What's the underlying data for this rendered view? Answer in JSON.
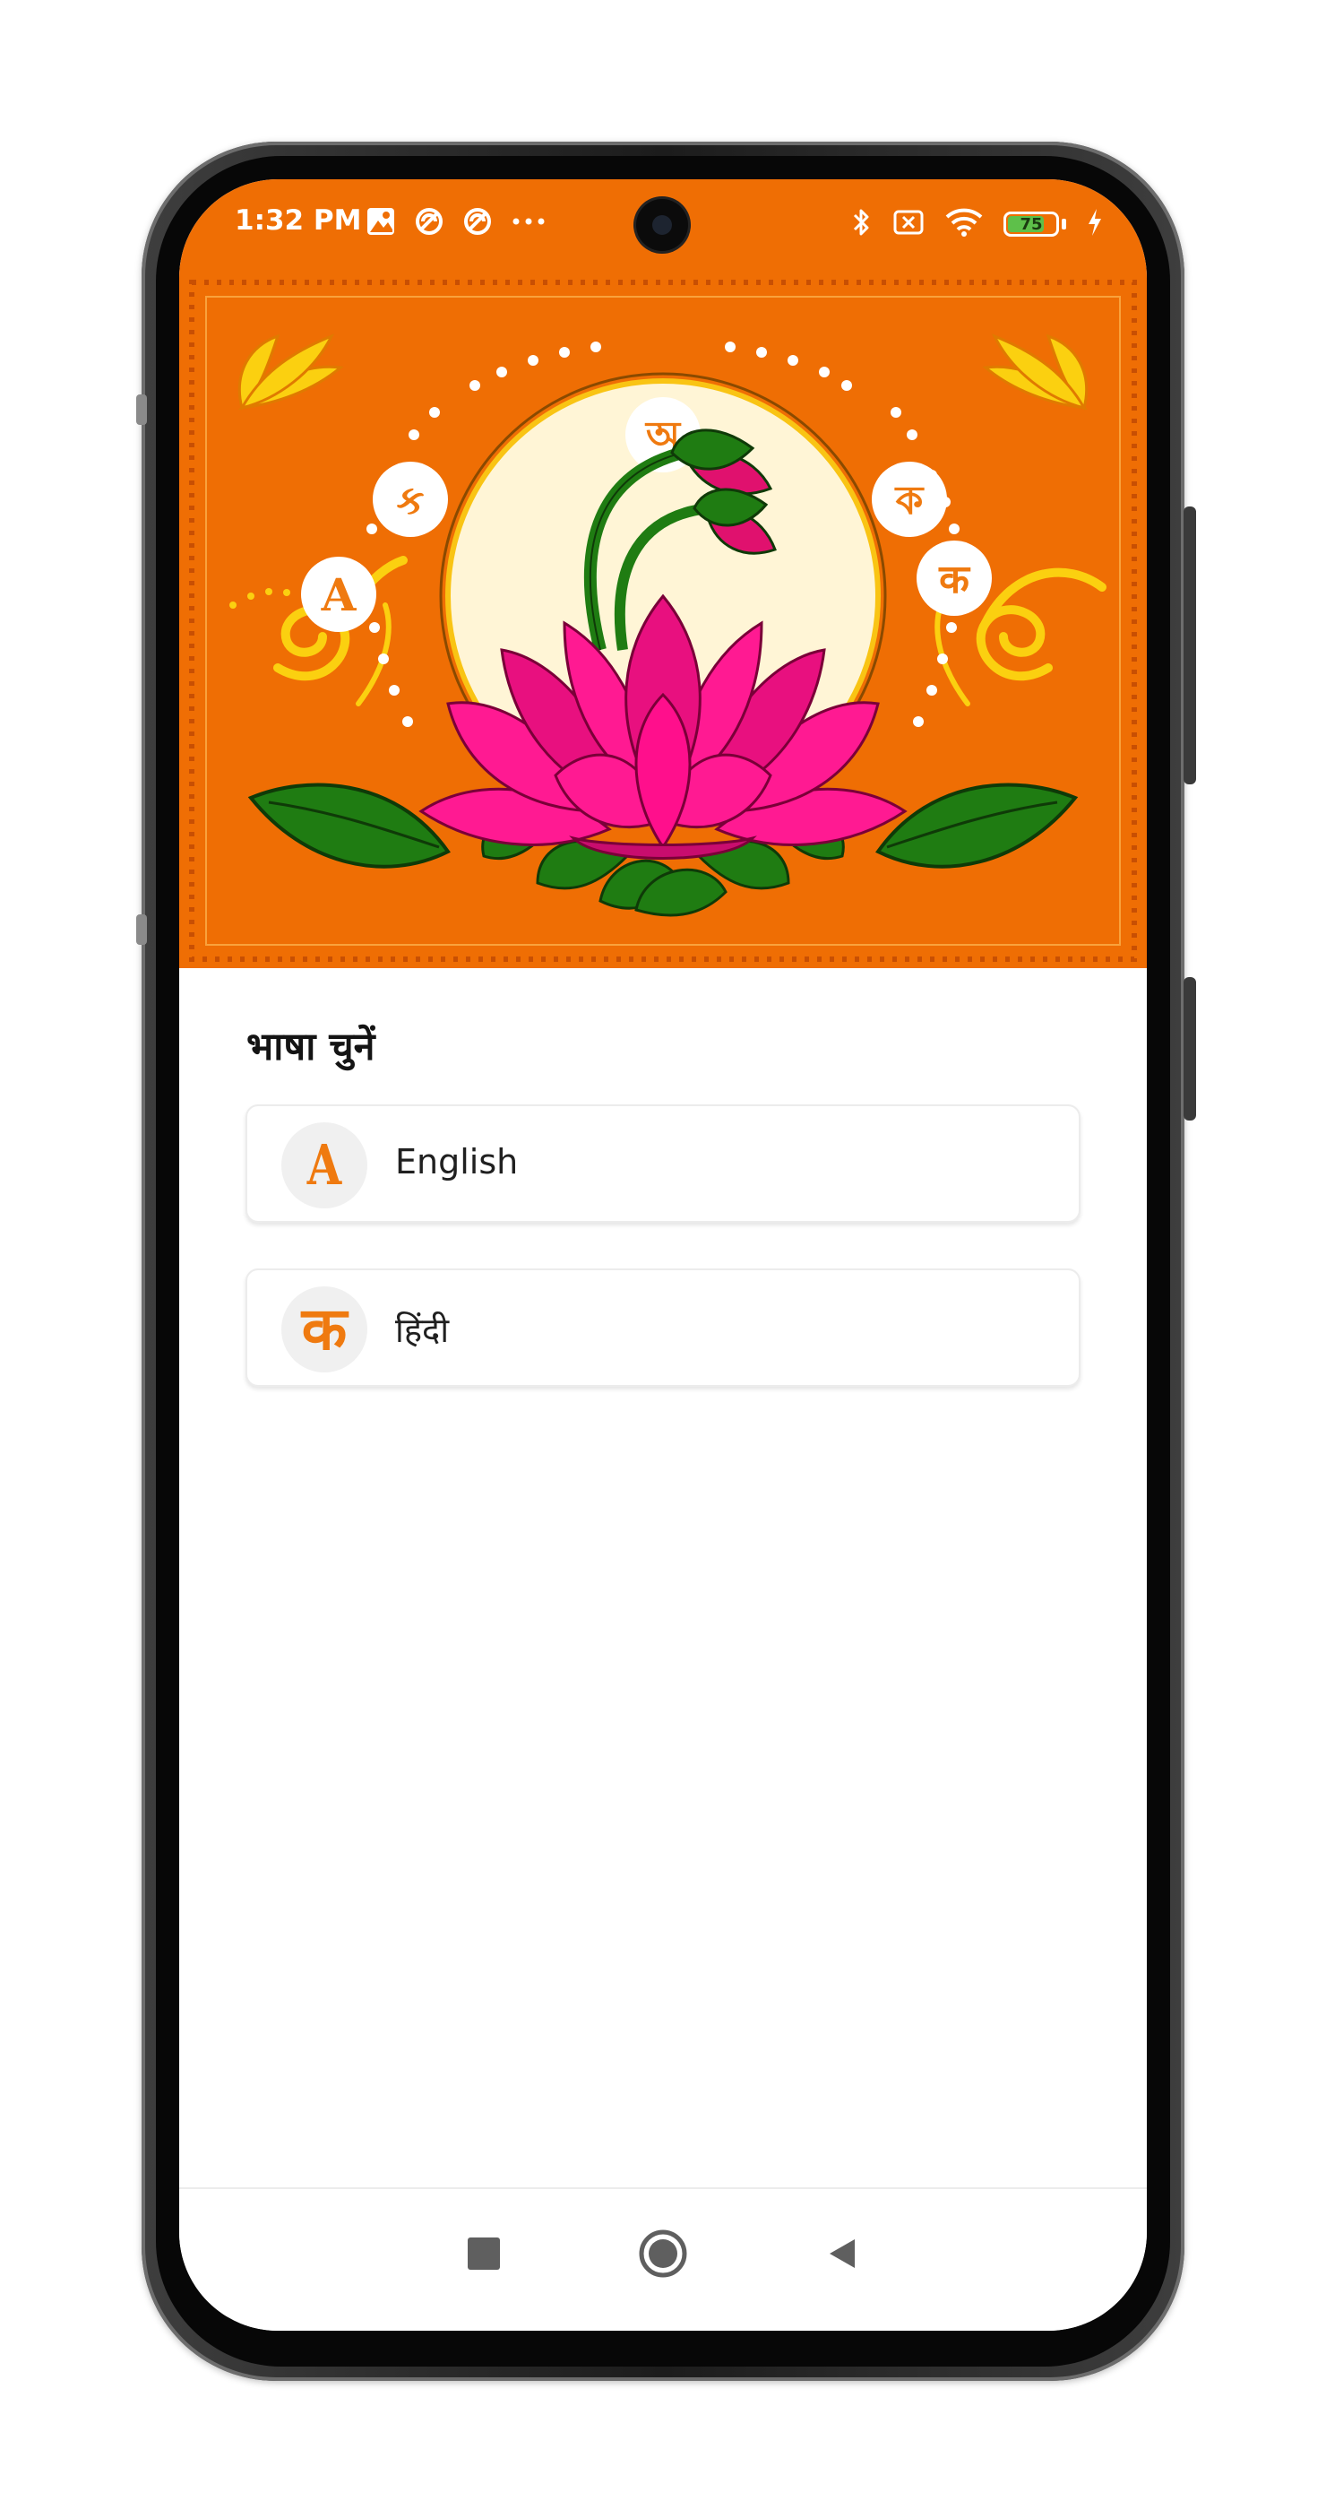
{
  "status_bar": {
    "time": "1:32 PM",
    "left_icons": [
      "image-icon",
      "vpn-icon",
      "vpn-icon",
      "more-dots-icon"
    ],
    "right_icons": [
      "bluetooth-icon",
      "sim-off-icon",
      "wifi-icon",
      "battery-icon",
      "charging-icon"
    ],
    "battery_level": "75"
  },
  "hero": {
    "script_badges": [
      "A",
      "ક",
      "অ",
      "ক",
      "क"
    ],
    "colors": {
      "background": "#ef6e04",
      "lotus": "#ff0f8c",
      "leaf": "#1f7c12",
      "moon": "#fff5d6",
      "accent": "#f9c414"
    }
  },
  "language_picker": {
    "title": "भाषा चुनें",
    "options": [
      {
        "label": "English",
        "glyph": "A",
        "icon": "letter-a-icon"
      },
      {
        "label": "हिंदी",
        "glyph": "क",
        "icon": "letter-ka-icon"
      }
    ]
  },
  "navigation": {
    "buttons": [
      "recents-icon",
      "home-icon",
      "back-icon"
    ]
  },
  "colors": {
    "accent": "#ef7a10",
    "status_bar": "#ef6e04"
  }
}
